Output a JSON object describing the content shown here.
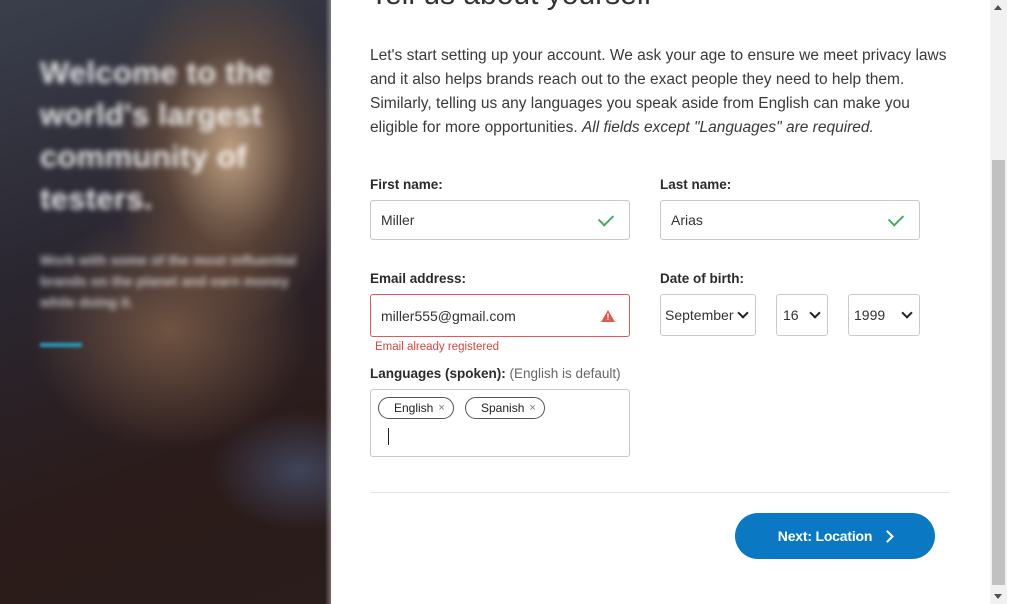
{
  "hero": {
    "title": "Welcome to the world's largest community of testers.",
    "subtitle": "Work with some of the most influential brands on the planet and earn money while doing it."
  },
  "page": {
    "heading": "Tell us about yourself",
    "intro": "Let's start setting up your account. We ask your age to ensure we meet privacy laws and it also helps brands reach out to the exact people they need to help them. Similarly, telling us any languages you speak aside from English can make you eligible for more opportunities. ",
    "intro_note": "All fields except \"Languages\" are required."
  },
  "form": {
    "first_name": {
      "label": "First name:",
      "value": "Miller",
      "status": "valid"
    },
    "last_name": {
      "label": "Last name:",
      "value": "Arias",
      "status": "valid"
    },
    "email": {
      "label": "Email address:",
      "value": "miller555@gmail.com",
      "status": "error",
      "error": "Email already registered"
    },
    "dob": {
      "label": "Date of birth:",
      "month": "September",
      "day": "16",
      "year": "1999"
    },
    "languages": {
      "label": "Languages (spoken):",
      "note": "(English is default)",
      "tags": [
        "English",
        "Spanish"
      ],
      "remove_glyph": "×"
    }
  },
  "actions": {
    "next_label": "Next: Location"
  },
  "colors": {
    "accent": "#0b78c4",
    "error": "#d9453f",
    "success": "#3fae5a"
  }
}
